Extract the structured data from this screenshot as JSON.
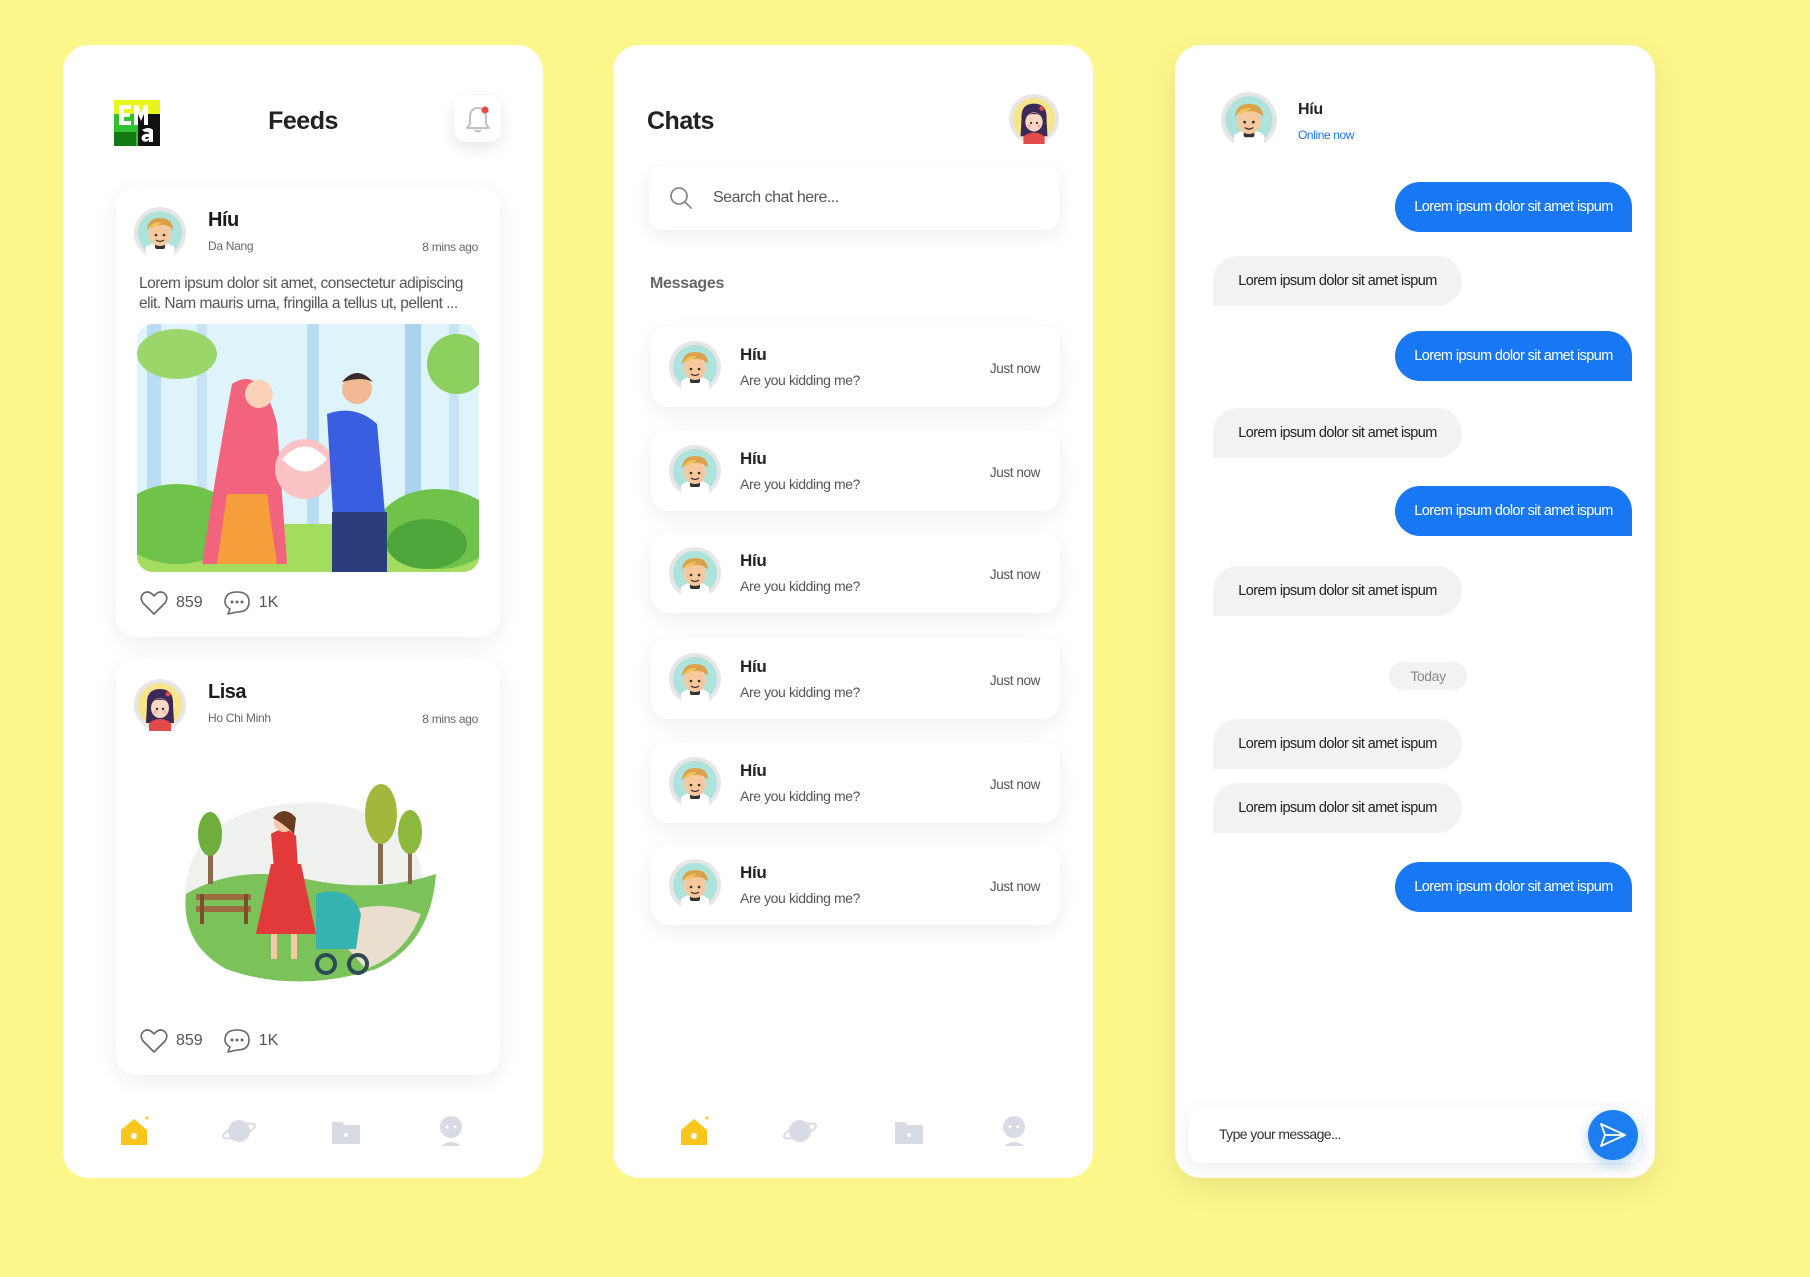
{
  "colors": {
    "background": "#fdf68b",
    "accent_blue": "#1877f2",
    "home_active": "#f8c51a",
    "nav_inactive": "#d8dbe3"
  },
  "feeds": {
    "title": "Feeds",
    "posts": [
      {
        "author": "Híu",
        "location": "Da Nang",
        "time": "8 mins ago",
        "text": "Lorem ipsum dolor sit amet, consectetur adipiscing elit. Nam mauris urna, fringilla a tellus ut, pellent ...",
        "likes": "859",
        "comments": "1K"
      },
      {
        "author": "Lisa",
        "location": "Ho Chi Minh",
        "time": "8 mins ago",
        "likes": "859",
        "comments": "1K"
      }
    ]
  },
  "chats": {
    "title": "Chats",
    "search_placeholder": "Search chat here...",
    "messages_label": "Messages",
    "items": [
      {
        "name": "Híu",
        "preview": "Are you kidding me?",
        "time": "Just now"
      },
      {
        "name": "Híu",
        "preview": "Are you kidding me?",
        "time": "Just now"
      },
      {
        "name": "Híu",
        "preview": "Are you kidding me?",
        "time": "Just now"
      },
      {
        "name": "Híu",
        "preview": "Are you kidding me?",
        "time": "Just now"
      },
      {
        "name": "Híu",
        "preview": "Are you kidding me?",
        "time": "Just now"
      },
      {
        "name": "Híu",
        "preview": "Are you kidding me?",
        "time": "Just now"
      }
    ]
  },
  "conversation": {
    "contact_name": "Híu",
    "contact_status": "Online now",
    "divider": "Today",
    "messages": [
      {
        "dir": "out",
        "text": "Lorem ipsum dolor sit amet ispum"
      },
      {
        "dir": "in",
        "text": "Lorem ipsum dolor sit amet ispum"
      },
      {
        "dir": "out",
        "text": "Lorem ipsum dolor sit amet ispum"
      },
      {
        "dir": "in",
        "text": "Lorem ipsum dolor sit amet ispum"
      },
      {
        "dir": "out",
        "text": "Lorem ipsum dolor sit amet ispum"
      },
      {
        "dir": "in",
        "text": "Lorem ipsum dolor sit amet ispum"
      },
      {
        "dir": "in",
        "text": "Lorem ipsum dolor sit amet ispum"
      },
      {
        "dir": "in",
        "text": "Lorem ipsum dolor sit amet ispum"
      },
      {
        "dir": "out",
        "text": "Lorem ipsum dolor sit amet ispum"
      }
    ],
    "composer_placeholder": "Type your message..."
  },
  "icons": {
    "bell": "bell-icon",
    "search": "search-icon",
    "like": "heart-icon",
    "comment": "comment-icon",
    "send": "send-icon",
    "nav": [
      "home-icon",
      "planet-icon",
      "folder-icon",
      "profile-icon"
    ]
  }
}
